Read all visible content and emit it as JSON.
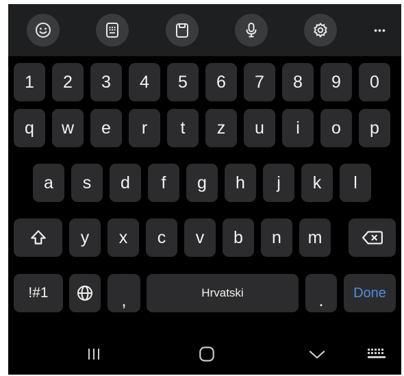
{
  "toolbar": {
    "items": [
      "emoji-icon",
      "keyboard-mode-icon",
      "clipboard-icon",
      "microphone-icon",
      "settings-icon"
    ],
    "more_label": "•••"
  },
  "keyboard": {
    "number_row": [
      "1",
      "2",
      "3",
      "4",
      "5",
      "6",
      "7",
      "8",
      "9",
      "0"
    ],
    "row1": [
      "q",
      "w",
      "e",
      "r",
      "t",
      "z",
      "u",
      "i",
      "o",
      "p"
    ],
    "row2": [
      "a",
      "s",
      "d",
      "f",
      "g",
      "h",
      "j",
      "k",
      "l"
    ],
    "row3": [
      "y",
      "x",
      "c",
      "v",
      "b",
      "n",
      "m"
    ],
    "symbols_label": "!#1",
    "comma_label": ",",
    "space_label": "Hrvatski",
    "period_label": ".",
    "done_label": "Done"
  },
  "navbar": {
    "items": [
      "recent-apps-icon",
      "home-icon",
      "hide-keyboard-icon",
      "keyboard-switch-icon"
    ]
  },
  "colors": {
    "background": "#000000",
    "toolbar": "#1e1f21",
    "key": "#2c2c2e",
    "key_text": "#f2f2f2",
    "accent": "#4a8fe0"
  }
}
